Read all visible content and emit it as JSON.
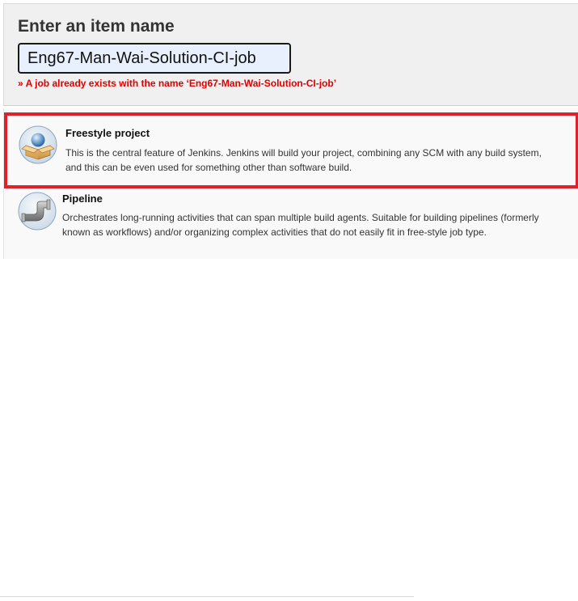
{
  "header": {
    "title": "Enter an item name",
    "item_name_value": "Eng67-Man-Wai-Solution-CI-job",
    "error_message": "» A job already exists with the name ‘Eng67-Man-Wai-Solution-CI-job’"
  },
  "items": [
    {
      "title": "Freestyle project",
      "description": "This is the central feature of Jenkins. Jenkins will build your project, combining any SCM with any build system, and this can be even used for something other than software build.",
      "icon": "freestyle-project-icon",
      "highlighted": true
    },
    {
      "title": "Pipeline",
      "description": "Orchestrates long-running activities that can span multiple build agents. Suitable for building pipelines (formerly known as workflows) and/or organizing complex activities that do not easily fit in free-style job type.",
      "icon": "pipeline-icon",
      "highlighted": false
    }
  ],
  "colors": {
    "error_text": "#e00000",
    "highlight_border": "#e0202a",
    "header_background": "#f0f0f0",
    "input_background": "#e8f0fe"
  }
}
